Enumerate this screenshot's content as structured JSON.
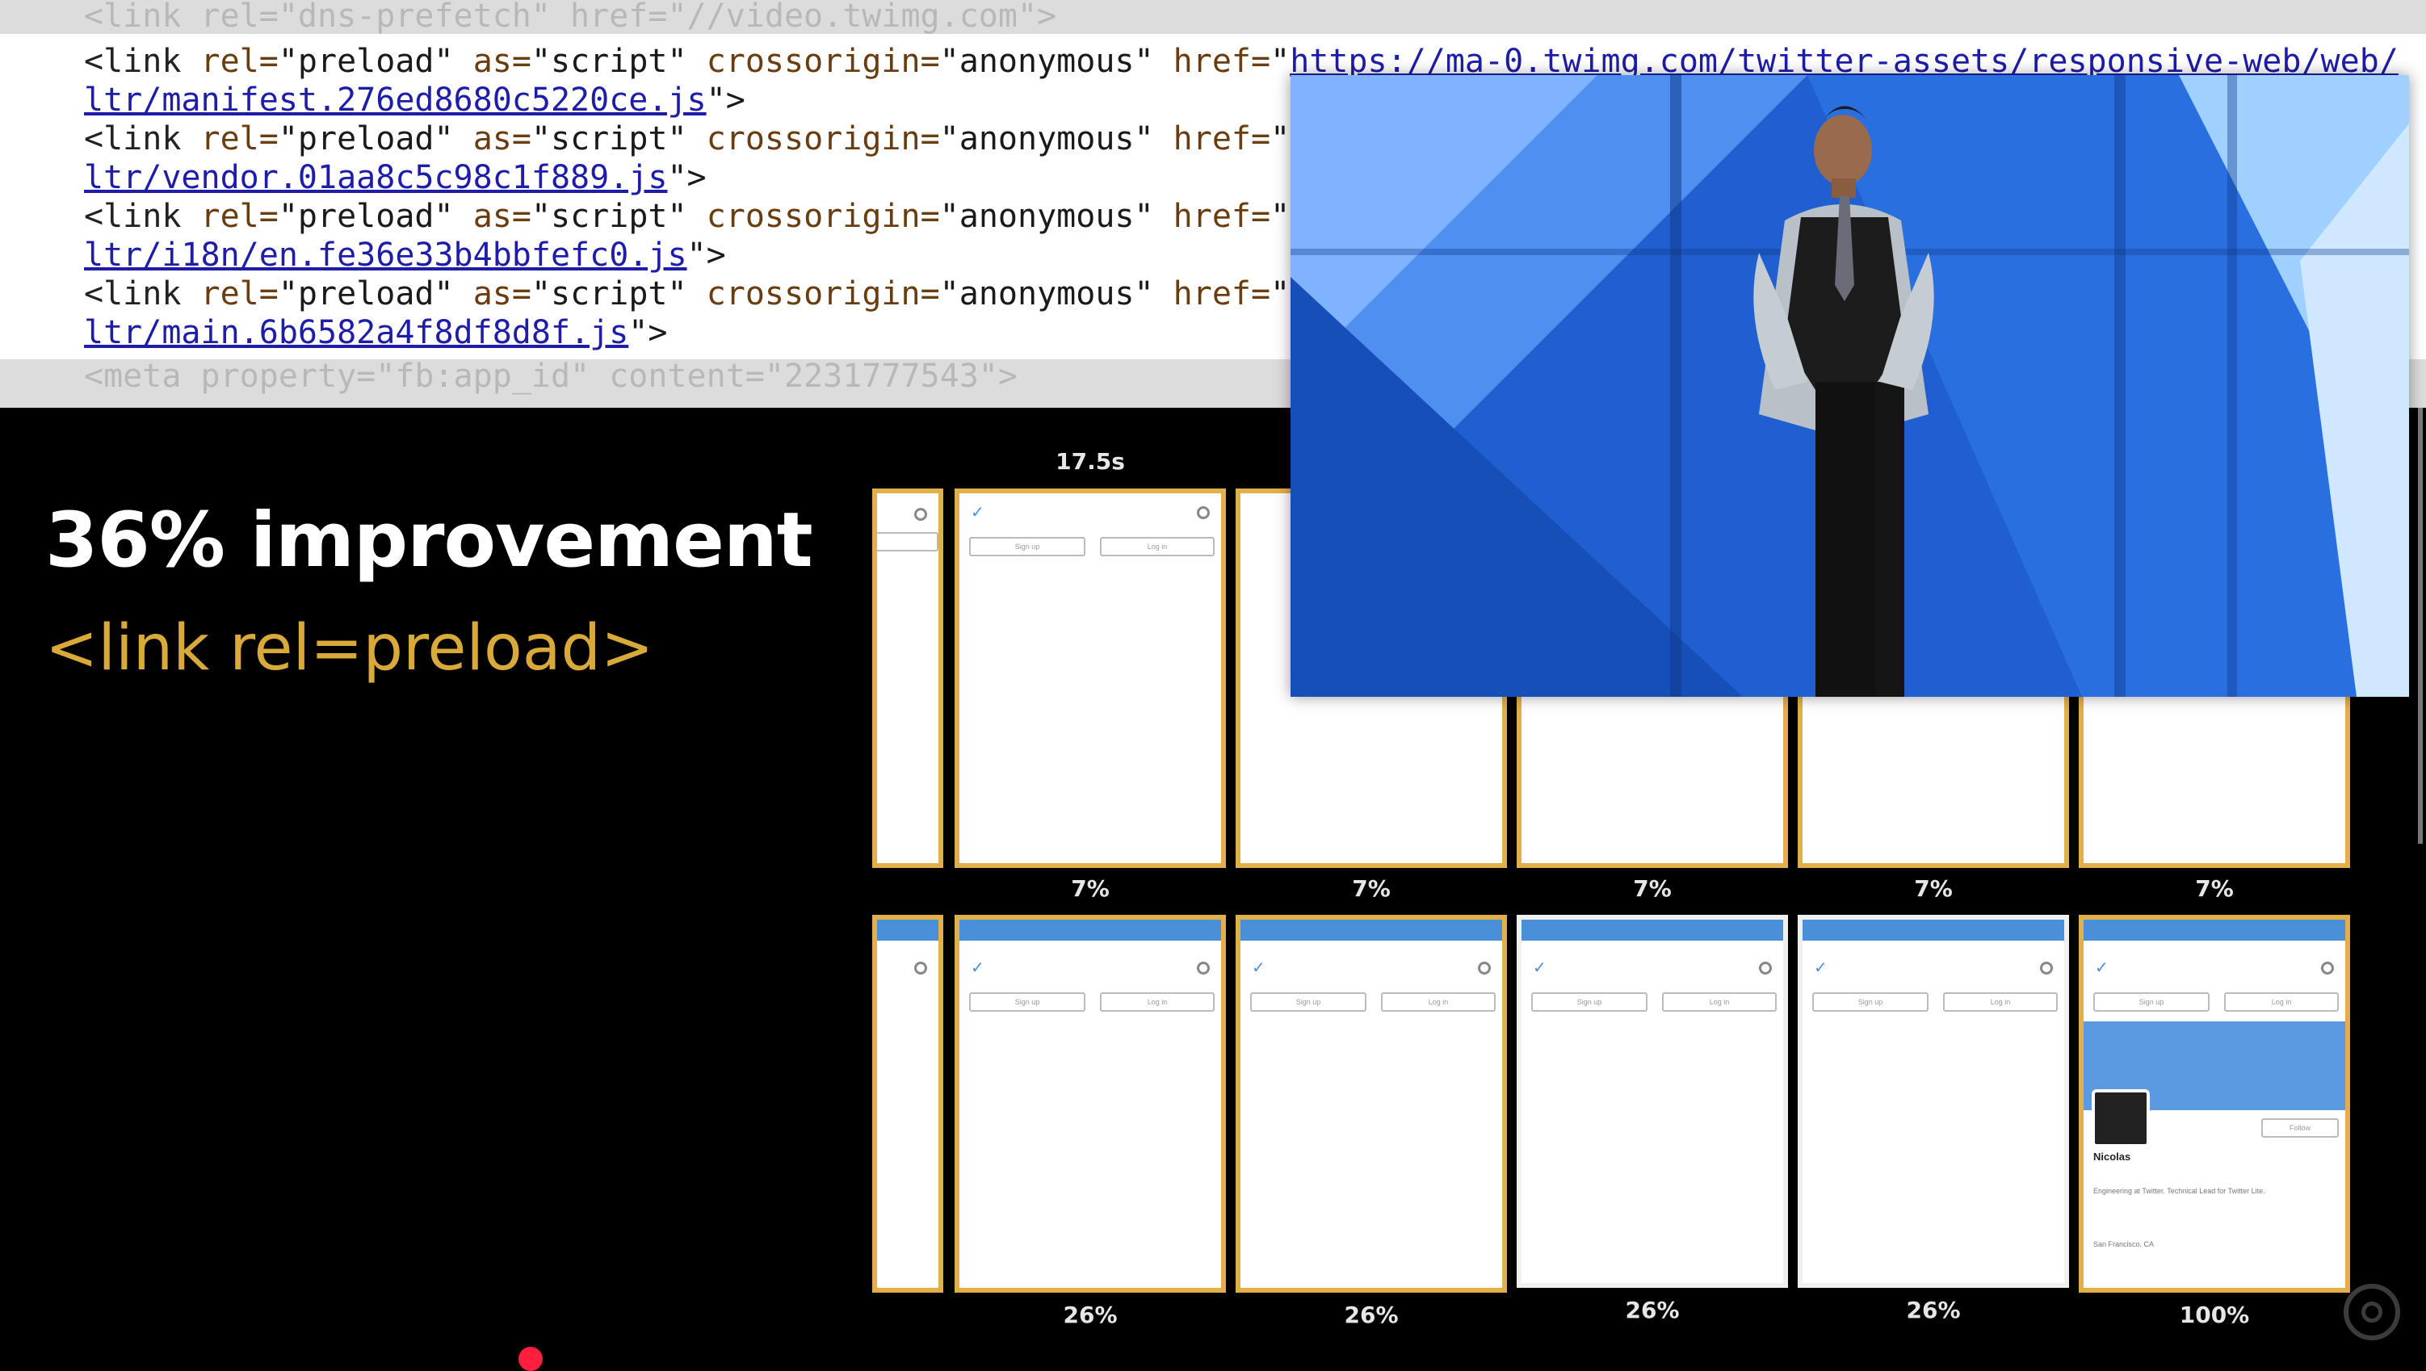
{
  "code": {
    "faded_top": "<link rel=\"dns-prefetch\" href=\"//video.twimg.com\">",
    "lines": [
      {
        "tag": "<link",
        "rel_attr": "rel=",
        "rel": "\"preload\"",
        "as_attr": "as=",
        "as": "\"script\"",
        "co_attr": "crossorigin=",
        "co": "\"anonymous\"",
        "href_attr": "href=",
        "href_q": "\"",
        "href": "https://ma-0.twimg.com/twitter-assets/responsive-web/web/"
      },
      {
        "cont": "ltr/manifest.276ed8680c5220ce.js",
        "close": "\">"
      },
      {
        "tag": "<link",
        "rel_attr": "rel=",
        "rel": "\"preload\"",
        "as_attr": "as=",
        "as": "\"script\"",
        "co_attr": "crossorigin=",
        "co": "\"anonymous\"",
        "href_attr": "href=",
        "href_q": "\"",
        "href": ""
      },
      {
        "cont": "ltr/vendor.01aa8c5c98c1f889.js",
        "close": "\">"
      },
      {
        "tag": "<link",
        "rel_attr": "rel=",
        "rel": "\"preload\"",
        "as_attr": "as=",
        "as": "\"script\"",
        "co_attr": "crossorigin=",
        "co": "\"anonymous\"",
        "href_attr": "href=",
        "href_q": "\"",
        "href": ""
      },
      {
        "cont": "ltr/i18n/en.fe36e33b4bbfefc0.js",
        "close": "\">"
      },
      {
        "tag": "<link",
        "rel_attr": "rel=",
        "rel": "\"preload\"",
        "as_attr": "as=",
        "as": "\"script\"",
        "co_attr": "crossorigin=",
        "co": "\"anonymous\"",
        "href_attr": "href=",
        "href_q": "\"",
        "href": ""
      },
      {
        "cont": "ltr/main.6b6582a4f8df8d8f.js",
        "close": "\">"
      }
    ],
    "faded_bottom": "<meta property=\"fb:app_id\" content=\"2231777543\">"
  },
  "slide": {
    "headline": "36% improvement",
    "subhead": "<link rel=preload>"
  },
  "filmstrip": {
    "time_label": "17.5s",
    "top_row_pct": [
      "7%",
      "7%",
      "7%",
      "7%",
      "7%"
    ],
    "bottom_row_pct": [
      "26%",
      "26%",
      "26%",
      "26%",
      "100%"
    ],
    "frame_buttons": {
      "signup": "Sign up",
      "login": "Log in"
    },
    "profile": {
      "name": "Nicolas",
      "follow": "Follow",
      "bio": "Engineering at Twitter. Technical Lead for Twitter Lite.",
      "location": "San Francisco, CA"
    }
  },
  "colors": {
    "frame_border": "#e2b04a",
    "accent": "#d9a93a",
    "twitter_blue": "#4a90d9",
    "stage_blue": "#1f5fcf"
  },
  "icons": {
    "frame_bird": "twitter-bird-icon",
    "frame_search": "search-icon",
    "brand": "chrome-logo-icon"
  }
}
